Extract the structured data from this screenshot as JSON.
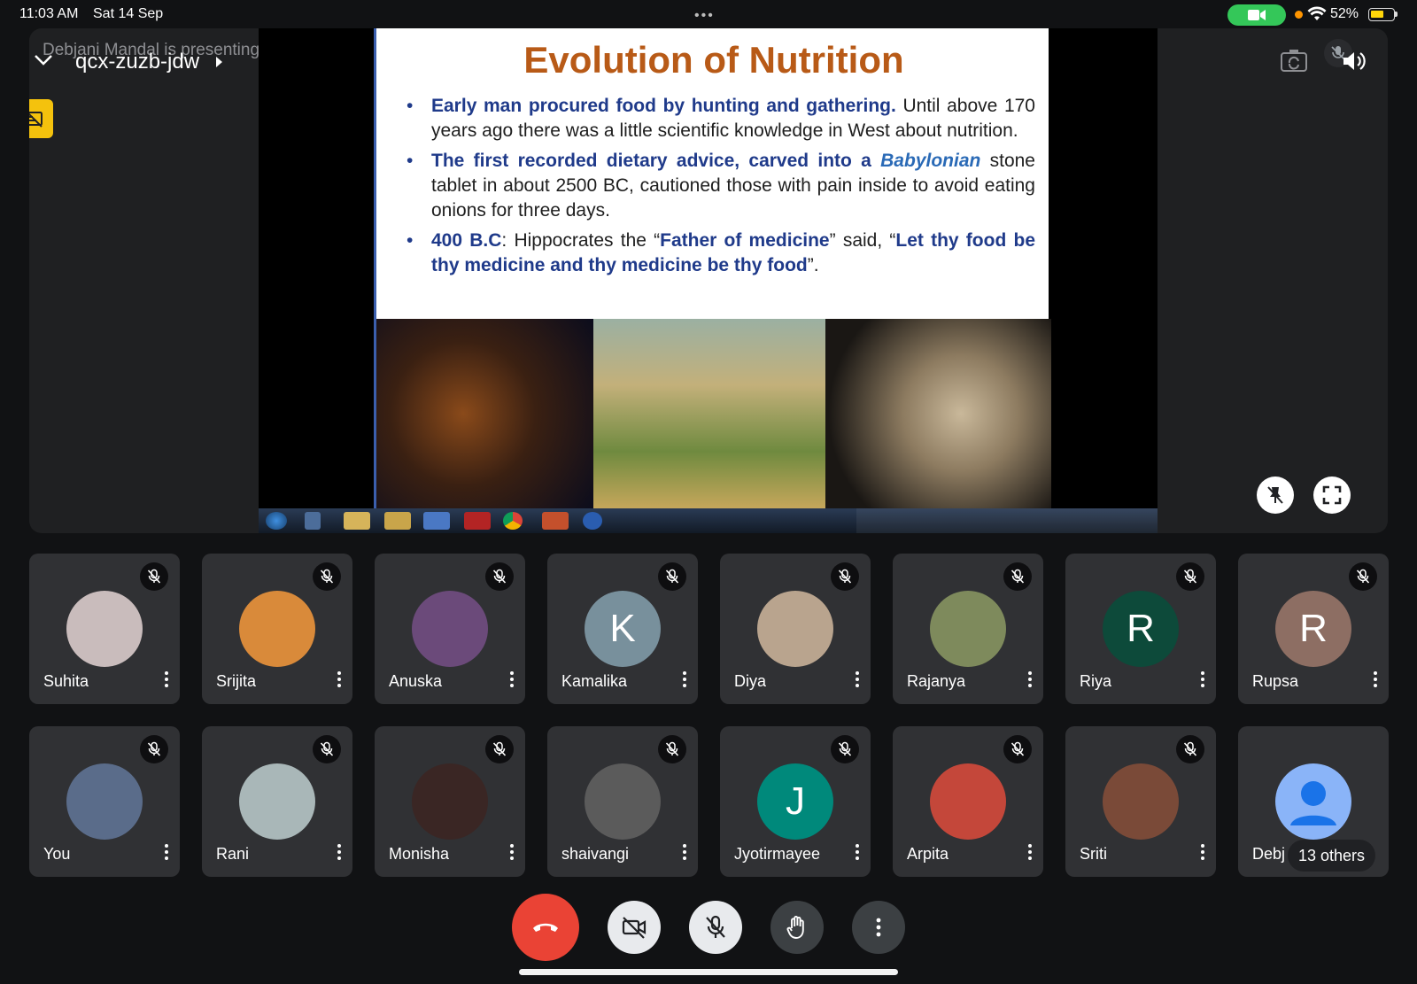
{
  "status_bar": {
    "time": "11:03 AM",
    "date": "Sat 14 Sep",
    "battery_percent": "52%",
    "battery_level": 0.52,
    "icons": [
      "multitask-dots-icon",
      "camera-in-use-icon",
      "recording-dot-icon",
      "wifi-icon",
      "battery-icon"
    ]
  },
  "meeting": {
    "presenting_label": "Debjani Mandal is presenting",
    "meeting_code": "qcx-zuzb-jdw"
  },
  "slide": {
    "title": "Evolution of Nutrition",
    "bullet1_bold": "Early man procured food by hunting and gathering.",
    "bullet1_rest": " Until above 170 years ago there was a little scientific knowledge in West about nutrition.",
    "bullet2_bold": "The first recorded dietary advice, carved into a ",
    "bullet2_italic": "Babylonian",
    "bullet2_rest": " stone tablet in about 2500 BC, cautioned those with pain inside to avoid eating onions for three days.",
    "bullet3_bold": "400 B.C",
    "bullet3_mid": ": Hippocrates the “",
    "bullet3_bold2": "Father of medicine",
    "bullet3_mid2": "” said, “",
    "bullet3_bold3": "Let thy food be thy medicine and thy medicine be thy food",
    "bullet3_end": "”."
  },
  "participants": [
    {
      "name": "Suhita",
      "initial": "",
      "avatar_bg": "#c9bcbc",
      "muted": true
    },
    {
      "name": "Srijita",
      "initial": "",
      "avatar_bg": "#d98a3a",
      "muted": true
    },
    {
      "name": "Anuska",
      "initial": "",
      "avatar_bg": "#6b4a7a",
      "muted": true
    },
    {
      "name": "Kamalika",
      "initial": "K",
      "avatar_bg": "#78909c",
      "muted": true
    },
    {
      "name": "Diya",
      "initial": "",
      "avatar_bg": "#b9a48e",
      "muted": true
    },
    {
      "name": "Rajanya",
      "initial": "",
      "avatar_bg": "#7e8a5c",
      "muted": true
    },
    {
      "name": "Riya",
      "initial": "R",
      "avatar_bg": "#0d4a3a",
      "muted": true
    },
    {
      "name": "Rupsa",
      "initial": "R",
      "avatar_bg": "#8d6e63",
      "muted": true
    },
    {
      "name": "You",
      "initial": "",
      "avatar_bg": "#5a6c8a",
      "muted": true
    },
    {
      "name": "Rani",
      "initial": "",
      "avatar_bg": "#a9b7b8",
      "muted": true
    },
    {
      "name": "Monisha",
      "initial": "",
      "avatar_bg": "#3a2624",
      "muted": true
    },
    {
      "name": "shaivangi",
      "initial": "",
      "avatar_bg": "#5b5b5b",
      "muted": true
    },
    {
      "name": "Jyotirmayee",
      "initial": "J",
      "avatar_bg": "#00897b",
      "muted": true
    },
    {
      "name": "Arpita",
      "initial": "",
      "avatar_bg": "#c4473a",
      "muted": true
    },
    {
      "name": "Sriti",
      "initial": "",
      "avatar_bg": "#7a4a38",
      "muted": true
    },
    {
      "name": "Debj",
      "initial": "",
      "avatar_bg": "#8ab4f8",
      "muted": false,
      "others_label": "13 others"
    }
  ],
  "controls": [
    "end-call-button",
    "camera-off-button",
    "microphone-off-button",
    "raise-hand-button",
    "more-options-button"
  ]
}
